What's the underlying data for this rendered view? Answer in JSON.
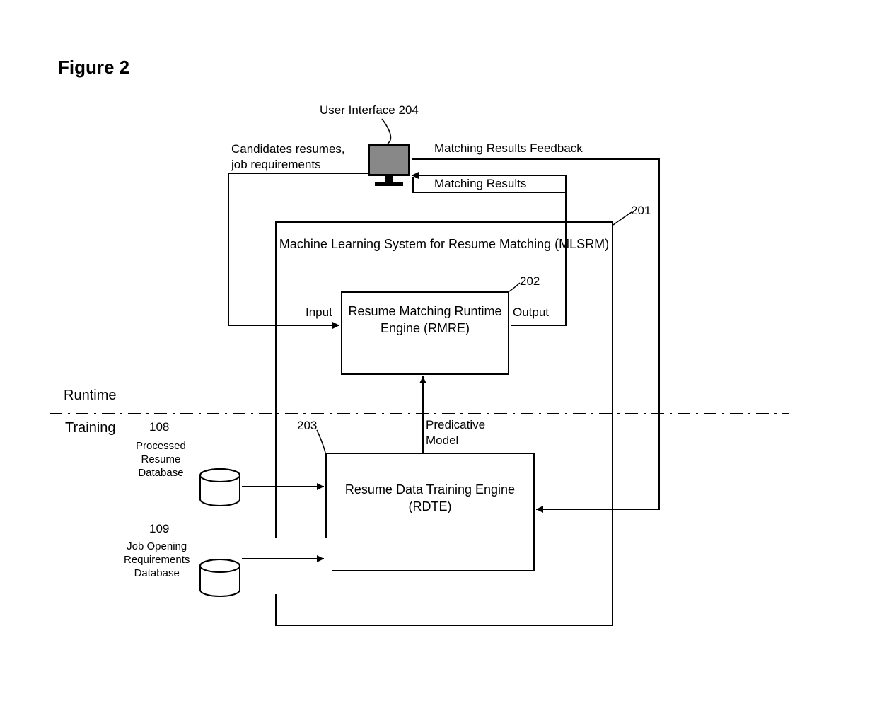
{
  "figure_title": "Figure 2",
  "labels": {
    "user_interface": "User Interface 204",
    "candidates_resumes": "Candidates resumes,\njob requirements",
    "matching_results_feedback": "Matching Results Feedback",
    "matching_results": "Matching Results",
    "runtime": "Runtime",
    "training": "Training",
    "input": "Input",
    "output": "Output",
    "predicative_model": "Predicative\nModel",
    "ref_201": "201",
    "ref_202": "202",
    "ref_203": "203",
    "ref_108": "108",
    "ref_109": "109",
    "processed_resume_db": "Processed\nResume\nDatabase",
    "job_opening_db": "Job Opening\nRequirements\nDatabase"
  },
  "boxes": {
    "mlsrm": "Machine Learning System\nfor Resume Matching (MLSRM)",
    "rmre": "Resume Matching\nRuntime Engine\n(RMRE)",
    "rdte": "Resume Data\nTraining Engine\n(RDTE)"
  }
}
